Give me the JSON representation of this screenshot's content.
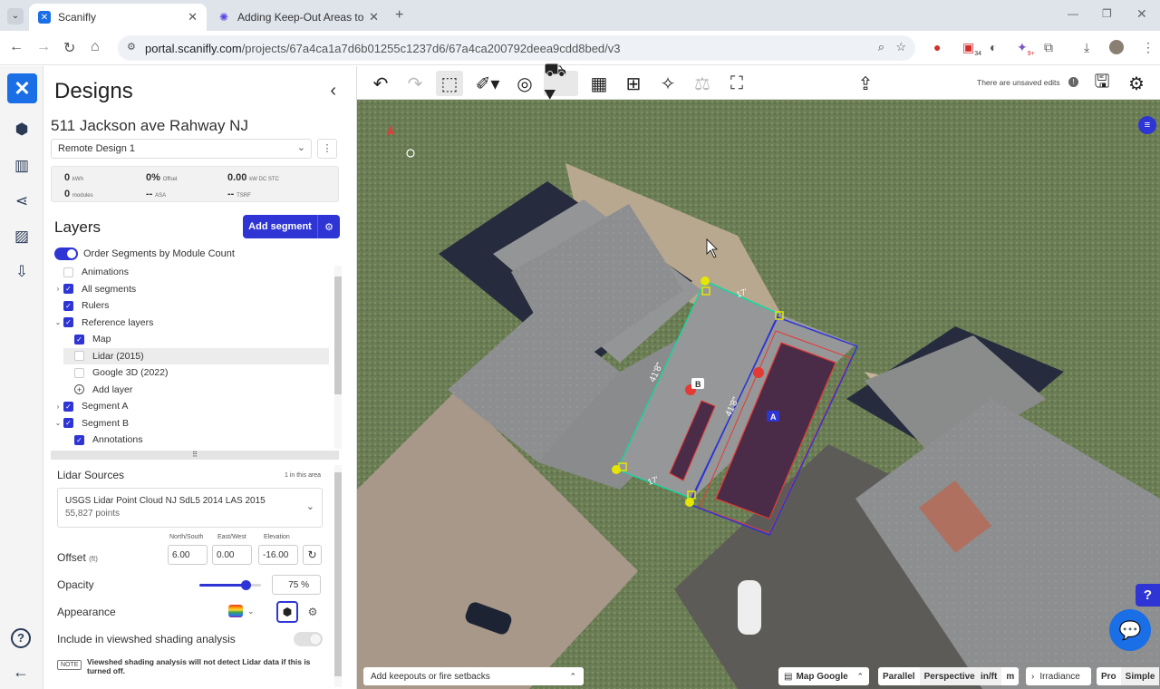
{
  "browser": {
    "tabs": [
      {
        "title": "Scanifly",
        "active": true
      },
      {
        "title": "Adding Keep-Out Areas to Roo",
        "active": false
      }
    ],
    "url_domain": "portal.scanifly.com",
    "url_path": "/projects/67a4ca1a7d6b01255c1237d6/67a4ca200792deea9cdd8bed/v3",
    "extension_badges": [
      "34",
      "9+"
    ]
  },
  "panel": {
    "title": "Designs",
    "address": "511 Jackson ave Rahway NJ",
    "design_select": "Remote Design 1",
    "stats": [
      {
        "value": "0",
        "unit": "kWh"
      },
      {
        "value": "0%",
        "unit": "Offset"
      },
      {
        "value": "0.00",
        "unit": "kW DC STC"
      },
      {
        "value": "0",
        "unit": "modules"
      },
      {
        "value": "--",
        "unit": "ASA"
      },
      {
        "value": "--",
        "unit": "TSRF"
      }
    ],
    "layers_title": "Layers",
    "add_segment": "Add segment",
    "order_toggle_label": "Order Segments by Module Count",
    "tree": [
      {
        "label": "Animations",
        "checked": false,
        "caret": "",
        "indent": 0
      },
      {
        "label": "All segments",
        "checked": true,
        "caret": "›",
        "indent": 0
      },
      {
        "label": "Rulers",
        "checked": true,
        "caret": "",
        "indent": 0
      },
      {
        "label": "Reference layers",
        "checked": true,
        "caret": "⌄",
        "indent": 0
      },
      {
        "label": "Map",
        "checked": true,
        "caret": "",
        "indent": 1
      },
      {
        "label": "Lidar (2015)",
        "checked": false,
        "caret": "",
        "indent": 1,
        "selected": true
      },
      {
        "label": "Google 3D (2022)",
        "checked": false,
        "caret": "",
        "indent": 1
      },
      {
        "label": "Add layer",
        "checked": "plus",
        "caret": "",
        "indent": 1
      },
      {
        "label": "Segment A",
        "checked": true,
        "caret": "›",
        "indent": 0
      },
      {
        "label": "Segment B",
        "checked": true,
        "caret": "⌄",
        "indent": 0
      },
      {
        "label": "Annotations",
        "checked": true,
        "caret": "",
        "indent": 1
      }
    ],
    "lidar": {
      "title": "Lidar Sources",
      "count": "1 in this area",
      "source_name": "USGS Lidar Point Cloud NJ SdL5 2014 LAS 2015",
      "points": "55,827 points"
    },
    "offset": {
      "label": "Offset",
      "unit": "(ft)",
      "fields": [
        {
          "label": "North/South",
          "value": "6.00"
        },
        {
          "label": "East/West",
          "value": "0.00"
        },
        {
          "label": "Elevation",
          "value": "-16.00"
        }
      ]
    },
    "opacity": {
      "label": "Opacity",
      "value": "75",
      "unit": "%",
      "fraction": 0.75
    },
    "appearance_label": "Appearance",
    "viewshed_label": "Include in viewshed shading analysis",
    "note_badge": "NOTE",
    "note_text": "Viewshed shading analysis will not detect Lidar data if this is turned off."
  },
  "toolbar": {
    "unsaved_text": "There are unsaved edits",
    "tool_icons": [
      "undo-icon",
      "redo-icon",
      "cube-icon",
      "pen-tool-icon",
      "orbit-icon",
      "cart-icon",
      "panel-edit-icon",
      "grid-icon",
      "bulb-icon",
      "scale-icon",
      "image-edit-icon",
      "upload-icon",
      "save-icon",
      "gear-icon"
    ]
  },
  "map": {
    "dimension_labels": [
      "17'",
      "41'8\"",
      "41'8\"",
      "17'"
    ],
    "segment_labels": [
      "A",
      "B"
    ],
    "keepouts_placeholder": "Add keepouts or fire setbacks",
    "map_source": "Map Google",
    "view_modes": [
      "Parallel",
      "Perspective"
    ],
    "units": [
      "in/ft",
      "m"
    ],
    "irradiance": "Irradiance",
    "modes": [
      "Pro",
      "Simple"
    ],
    "colors": {
      "accent": "#2e35d4",
      "setback": "#e53935",
      "edge": "#00e0a0",
      "vertex": "#e6e600"
    }
  }
}
